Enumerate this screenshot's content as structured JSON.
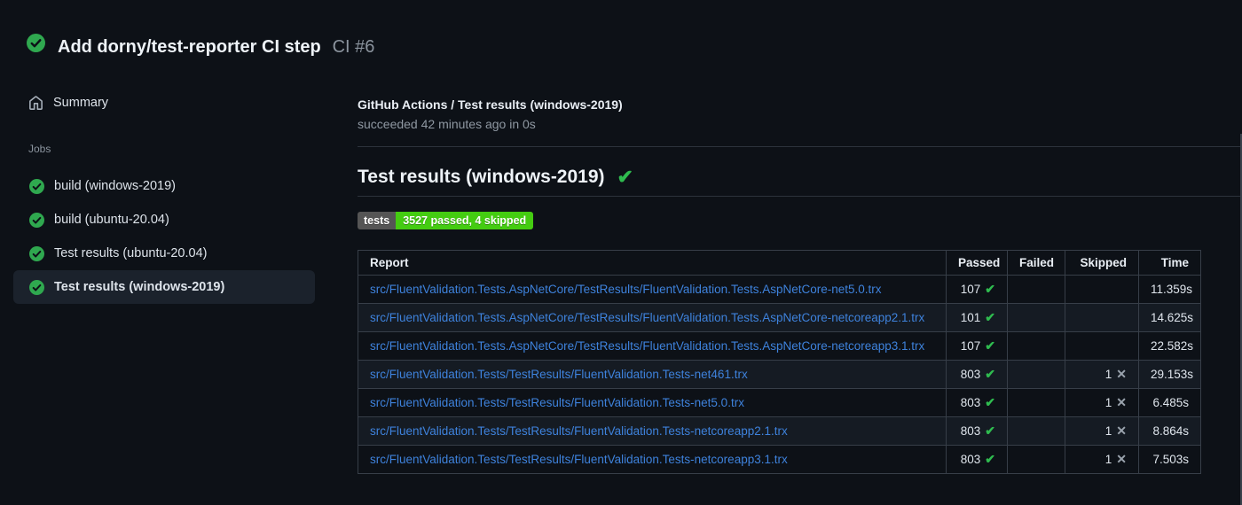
{
  "colors": {
    "background": "#0d1117",
    "success_green": "#2fbb4f",
    "badge_green": "#44cc11",
    "badge_gray": "#555555",
    "link_blue": "#3e82dc",
    "muted_text": "#8b949e"
  },
  "run_header": {
    "title": "Add dorny/test-reporter CI step",
    "run_id": "CI #6",
    "status_icon": "check-circle-icon"
  },
  "sidebar": {
    "summary_label": "Summary",
    "jobs_label": "Jobs",
    "jobs": [
      {
        "label": "build (windows-2019)",
        "status_icon": "check-circle-icon",
        "selected": false
      },
      {
        "label": "build (ubuntu-20.04)",
        "status_icon": "check-circle-icon",
        "selected": false
      },
      {
        "label": "Test results (ubuntu-20.04)",
        "status_icon": "check-circle-icon",
        "selected": false
      },
      {
        "label": "Test results (windows-2019)",
        "status_icon": "check-circle-icon",
        "selected": true
      }
    ]
  },
  "main": {
    "check_name": "GitHub Actions / Test results (windows-2019)",
    "check_status": "succeeded 42 minutes ago in 0s",
    "heading": "Test results (windows-2019)",
    "heading_check_icon": "✔",
    "badge": {
      "label": "tests",
      "value": "3527 passed, 4 skipped"
    },
    "table": {
      "headers": [
        "Report",
        "Passed",
        "Failed",
        "Skipped",
        "Time"
      ],
      "rows": [
        {
          "report": "src/FluentValidation.Tests.AspNetCore/TestResults/FluentValidation.Tests.AspNetCore-net5.0.trx",
          "passed": "107",
          "passed_icon": "✔",
          "failed": "",
          "skipped": "",
          "skipped_icon": "",
          "time": "11.359s"
        },
        {
          "report": "src/FluentValidation.Tests.AspNetCore/TestResults/FluentValidation.Tests.AspNetCore-netcoreapp2.1.trx",
          "passed": "101",
          "passed_icon": "✔",
          "failed": "",
          "skipped": "",
          "skipped_icon": "",
          "time": "14.625s"
        },
        {
          "report": "src/FluentValidation.Tests.AspNetCore/TestResults/FluentValidation.Tests.AspNetCore-netcoreapp3.1.trx",
          "passed": "107",
          "passed_icon": "✔",
          "failed": "",
          "skipped": "",
          "skipped_icon": "",
          "time": "22.582s"
        },
        {
          "report": "src/FluentValidation.Tests/TestResults/FluentValidation.Tests-net461.trx",
          "passed": "803",
          "passed_icon": "✔",
          "failed": "",
          "skipped": "1",
          "skipped_icon": "✕",
          "time": "29.153s"
        },
        {
          "report": "src/FluentValidation.Tests/TestResults/FluentValidation.Tests-net5.0.trx",
          "passed": "803",
          "passed_icon": "✔",
          "failed": "",
          "skipped": "1",
          "skipped_icon": "✕",
          "time": "6.485s"
        },
        {
          "report": "src/FluentValidation.Tests/TestResults/FluentValidation.Tests-netcoreapp2.1.trx",
          "passed": "803",
          "passed_icon": "✔",
          "failed": "",
          "skipped": "1",
          "skipped_icon": "✕",
          "time": "8.864s"
        },
        {
          "report": "src/FluentValidation.Tests/TestResults/FluentValidation.Tests-netcoreapp3.1.trx",
          "passed": "803",
          "passed_icon": "✔",
          "failed": "",
          "skipped": "1",
          "skipped_icon": "✕",
          "time": "7.503s"
        }
      ]
    }
  }
}
